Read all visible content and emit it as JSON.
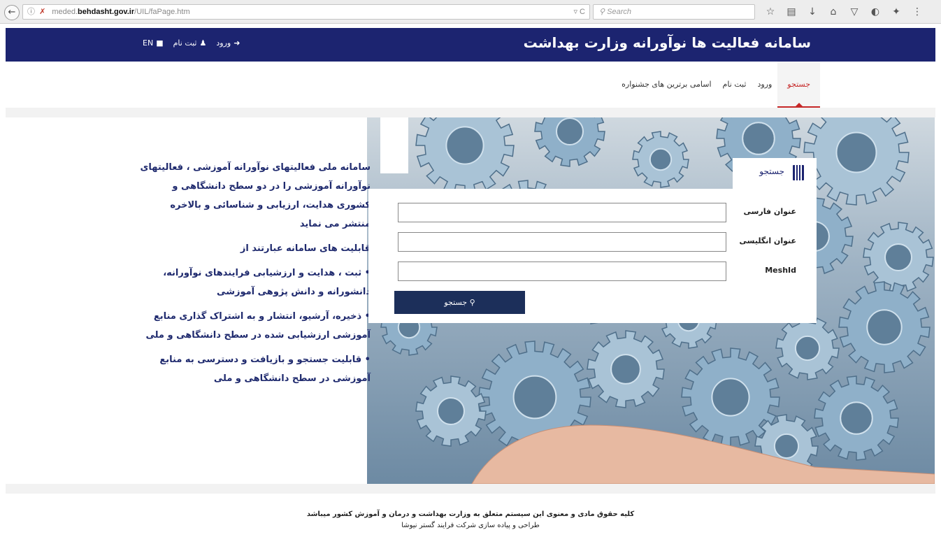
{
  "browser": {
    "url_path": "meded.",
    "url_domain": "behdasht.gov.ir",
    "url_rest": "/UIL/faPage.htm",
    "url_controls": "▿  C",
    "search_placeholder": "Search"
  },
  "header": {
    "title": "سامانه فعالیت ها نوآورانه وزارت بهداشت",
    "login": "ورود",
    "register": "ثبت نام",
    "lang": "EN"
  },
  "nav": {
    "items": [
      {
        "label": "جستجو"
      },
      {
        "label": "ورود"
      },
      {
        "label": "ثبت نام"
      },
      {
        "label": "اسامی برترین های جشنواره"
      }
    ]
  },
  "description": {
    "p1": "سامانه ملی فعالیتهای نوآورانه آموزشی ، فعالیتهای نوآورانه آموزشی را در دو سطح دانشگاهی و کشوری هدایت، ارزیابی و شناسائی و بالاخره منتشر می نماید",
    "p2": "قابلیت های سامانه عبارتند از",
    "p3": "• ثبت ، هدایت و ارزشیابی فرایندهای نوآورانه، دانشورانه و دانش پژوهی آموزشی",
    "p4": "• ذخیره، آرشیو، انتشار و به اشتراک گذاری منابع آموزشی ارزشیابی شده در سطح دانشگاهی و ملی",
    "p5": "• قابلیت جستجو و بازیافت و دسترسی به منابع آموزشی در سطح دانشگاهی و ملی"
  },
  "search_panel": {
    "tab_label": "جستجو",
    "field_fa_label": "عنوان فارسی",
    "field_en_label": "عنوان انگلیسی",
    "field_mesh_label": "MeshId",
    "button_label": "جستجو"
  },
  "footer": {
    "line1": "کلیه حقوق مادی و معنوی این سیستم متعلق به وزارت بهداشت و درمان و آموزش کشور میباشد",
    "line2": "طراحی و پیاده سازی شرکت فرایند گستر نیوشا"
  }
}
